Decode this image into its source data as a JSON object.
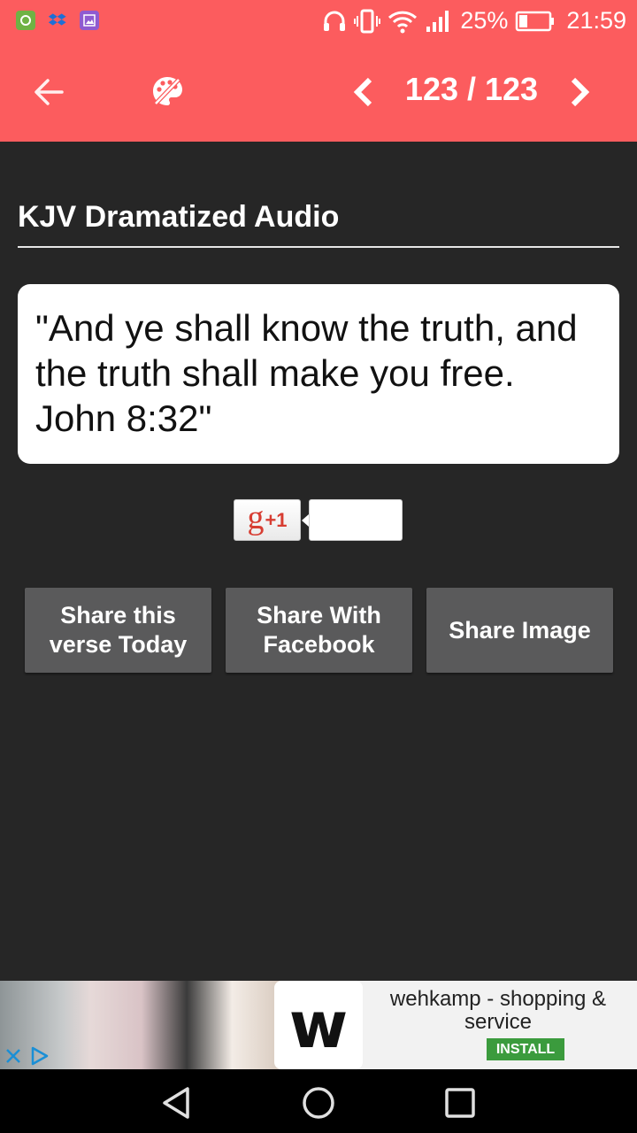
{
  "status_bar": {
    "battery": "25%",
    "time": "21:59",
    "icons": [
      "android-app-icon",
      "dropbox-icon",
      "gallery-icon",
      "headphones-icon",
      "vibrate-icon",
      "wifi-icon",
      "signal-icon",
      "battery-icon"
    ]
  },
  "app_bar": {
    "counter": "123 / 123",
    "icons": [
      "back-arrow-icon",
      "palette-icon",
      "chevron-left-icon",
      "chevron-right-icon"
    ],
    "color": "#fc5c5e"
  },
  "section": {
    "title": "KJV Dramatized Audio"
  },
  "verse": {
    "text": "\"And ye shall know the truth, and the truth shall make you free. John 8:32\""
  },
  "gplus": {
    "g": "g",
    "plus_one": "+1"
  },
  "buttons": {
    "share_today": "Share this verse Today",
    "share_facebook": "Share With Facebook",
    "share_image": "Share Image"
  },
  "ad": {
    "logo": "w",
    "title": "wehkamp - shopping & service",
    "install": "INSTALL",
    "install_color": "#3b9b3d"
  },
  "nav_bar": {
    "icons": [
      "back-triangle-icon",
      "home-circle-icon",
      "recents-square-icon"
    ]
  },
  "colors": {
    "background": "#262626",
    "button": "#5a5a5b"
  }
}
